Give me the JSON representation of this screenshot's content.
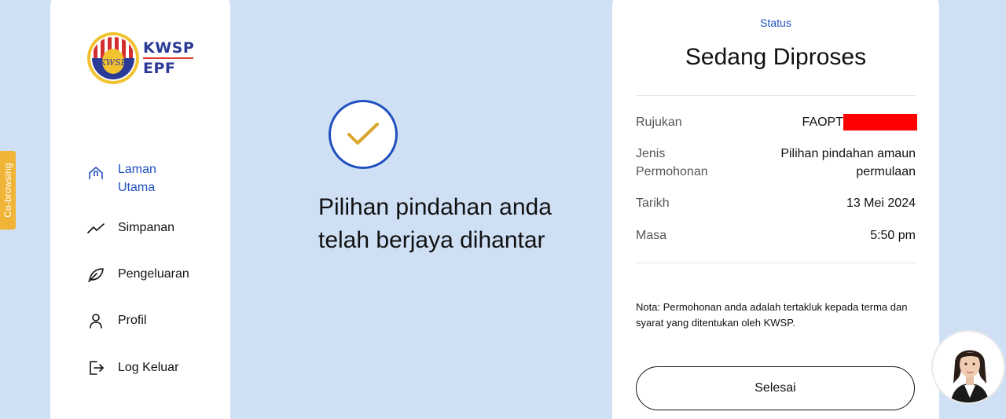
{
  "cobrowse": {
    "label": "Co-browsing"
  },
  "logo": {
    "line1": "KWSP",
    "line2": "EPF",
    "seal_text": "KWSP"
  },
  "sidebar": {
    "items": [
      {
        "label": "Laman Utama",
        "icon": "home-icon",
        "active": true
      },
      {
        "label": "Simpanan",
        "icon": "trend-icon",
        "active": false
      },
      {
        "label": "Pengeluaran",
        "icon": "leaf-icon",
        "active": false
      },
      {
        "label": "Profil",
        "icon": "user-icon",
        "active": false
      },
      {
        "label": "Log Keluar",
        "icon": "logout-icon",
        "active": false
      }
    ]
  },
  "main": {
    "message": "Pilihan pindahan anda telah berjaya dihantar"
  },
  "status_card": {
    "label": "Status",
    "title": "Sedang Diproses",
    "rows": [
      {
        "key": "Rujukan",
        "value": "FAOPT"
      },
      {
        "key": "Jenis Permohonan",
        "value": "Pilihan pindahan amaun permulaan"
      },
      {
        "key": "Tarikh",
        "value": "13 Mei 2024"
      },
      {
        "key": "Masa",
        "value": "5:50 pm"
      }
    ],
    "note": "Nota: Permohonan anda adalah tertakluk kepada terma dan syarat yang ditentukan oleh KWSP.",
    "button_label": "Selesai"
  },
  "colors": {
    "background": "#cfe0f5",
    "accent_blue": "#1f4fbf",
    "check_gold": "#d9a62e",
    "cobrowse_tab": "#f0b536",
    "redaction": "#ff0000"
  }
}
